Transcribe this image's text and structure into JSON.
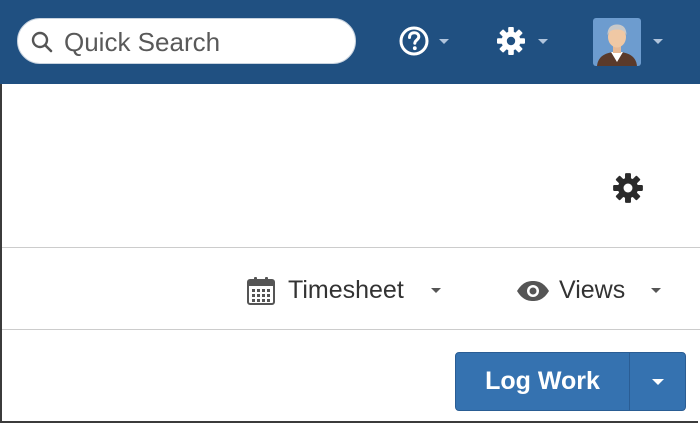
{
  "header": {
    "search_placeholder": "Quick Search",
    "icons": {
      "search": "search-icon",
      "help": "help-icon",
      "settings": "gear-icon",
      "profile": "avatar"
    },
    "bar_color": "#205081"
  },
  "panel": {
    "settings_icon": "gear-icon"
  },
  "toolbar": {
    "timesheet_label": "Timesheet",
    "timesheet_icon": "calendar-icon",
    "views_label": "Views",
    "views_icon": "eye-icon"
  },
  "actions": {
    "log_work_label": "Log Work",
    "button_color": "#3572b0"
  }
}
